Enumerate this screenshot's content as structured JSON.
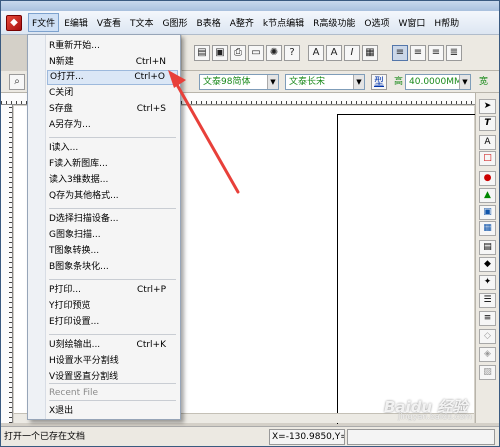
{
  "menubar": {
    "items": [
      "F文件",
      "E编辑",
      "V查看",
      "T文本",
      "G图形",
      "B表格",
      "A整齐",
      "k节点编辑",
      "R高级功能",
      "O选项",
      "W窗口",
      "H帮助"
    ]
  },
  "toolbar": {
    "font_cn": "文泰98简体",
    "font_en": "文泰长宋",
    "type_button": "型",
    "height_label": "高",
    "height_value": "40.0000MM",
    "width_label": "宽"
  },
  "file_menu": {
    "items": [
      {
        "label": "R重新开始...",
        "shortcut": ""
      },
      {
        "label": "N新建",
        "shortcut": "Ctrl+N"
      },
      {
        "label": "O打开...",
        "shortcut": "Ctrl+O"
      },
      {
        "label": "C关闭",
        "shortcut": ""
      },
      {
        "label": "S存盘",
        "shortcut": "Ctrl+S"
      },
      {
        "label": "A另存为...",
        "shortcut": ""
      },
      {
        "label": "I读入...",
        "shortcut": ""
      },
      {
        "label": "F读入新图库...",
        "shortcut": ""
      },
      {
        "label": "读入3维数据...",
        "shortcut": ""
      },
      {
        "label": "Q存为其他格式...",
        "shortcut": ""
      },
      {
        "label": "D选择扫描设备...",
        "shortcut": ""
      },
      {
        "label": "G图象扫描...",
        "shortcut": ""
      },
      {
        "label": "T图象转换...",
        "shortcut": ""
      },
      {
        "label": "B图象条块化...",
        "shortcut": ""
      },
      {
        "label": "P打印...",
        "shortcut": "Ctrl+P"
      },
      {
        "label": "Y打印预览",
        "shortcut": ""
      },
      {
        "label": "E打印设置...",
        "shortcut": ""
      },
      {
        "label": "U刻绘输出...",
        "shortcut": "Ctrl+K"
      },
      {
        "label": "H设置水平分割线",
        "shortcut": ""
      },
      {
        "label": "V设置竖直分割线",
        "shortcut": ""
      },
      {
        "label": "Recent File",
        "shortcut": ""
      },
      {
        "label": "X退出",
        "shortcut": ""
      }
    ]
  },
  "statusbar": {
    "message": "打开一个已存在文档",
    "coords": "X=-130.9850,Y=2("
  },
  "watermark": {
    "brand": "Baidu 经验",
    "url": "jingyan.baidu.com"
  },
  "colors": {
    "accent_arrow": "#e8403a",
    "menu_highlight": "#dbe7f6"
  }
}
